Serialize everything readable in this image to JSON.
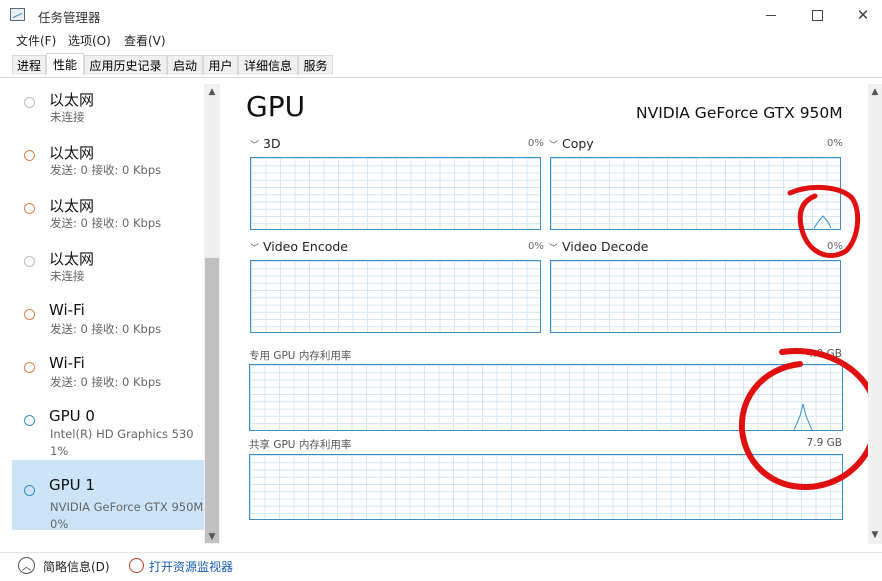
{
  "window": {
    "title": "任务管理器",
    "minimize_icon": "minimize-icon",
    "maximize_icon": "maximize-icon",
    "close_icon": "close-icon"
  },
  "menu": [
    "文件(F)",
    "选项(O)",
    "查看(V)"
  ],
  "tabs": [
    "进程",
    "性能",
    "应用历史记录",
    "启动",
    "用户",
    "详细信息",
    "服务"
  ],
  "active_tab": "性能",
  "sidebar": [
    {
      "title": "以太网",
      "line1": "未连接",
      "line2": "",
      "status_color": "#bdbdbd"
    },
    {
      "title": "以太网",
      "line1": "发送: 0 接收: 0 Kbps",
      "line2": "",
      "status_color": "#d9834a"
    },
    {
      "title": "以太网",
      "line1": "发送: 0 接收: 0 Kbps",
      "line2": "",
      "status_color": "#d9834a"
    },
    {
      "title": "以太网",
      "line1": "未连接",
      "line2": "",
      "status_color": "#bdbdbd"
    },
    {
      "title": "Wi-Fi",
      "line1": "发送: 0 接收: 0 Kbps",
      "line2": "",
      "status_color": "#d9834a"
    },
    {
      "title": "Wi-Fi",
      "line1": "发送: 0 接收: 0 Kbps",
      "line2": "",
      "status_color": "#d9834a"
    },
    {
      "title": "GPU 0",
      "line1": "Intel(R) HD Graphics 530",
      "line2": "1%",
      "status_color": "#3a8fc4"
    },
    {
      "title": "GPU 1",
      "line1": "NVIDIA GeForce GTX 950M",
      "line2": "0%",
      "status_color": "#3a8fc4",
      "selected": true
    }
  ],
  "main": {
    "title": "GPU",
    "device_name": "NVIDIA GeForce GTX 950M",
    "engines": [
      {
        "label": "3D",
        "percent": "0%"
      },
      {
        "label": "Copy",
        "percent": "0%"
      },
      {
        "label": "Video Encode",
        "percent": "0%"
      },
      {
        "label": "Video Decode",
        "percent": "0%"
      }
    ],
    "dedicated": {
      "label": "专用 GPU 内存利用率",
      "capacity": "4.0 GB"
    },
    "shared": {
      "label": "共享 GPU 内存利用率",
      "capacity": "7.9 GB"
    }
  },
  "footer": {
    "fewer_details": "简略信息(D)",
    "open_monitor": "打开资源监视器"
  },
  "colors": {
    "graph_border": "#3a8fc4",
    "annotation": "#e01010",
    "link": "#1a5fb4"
  }
}
